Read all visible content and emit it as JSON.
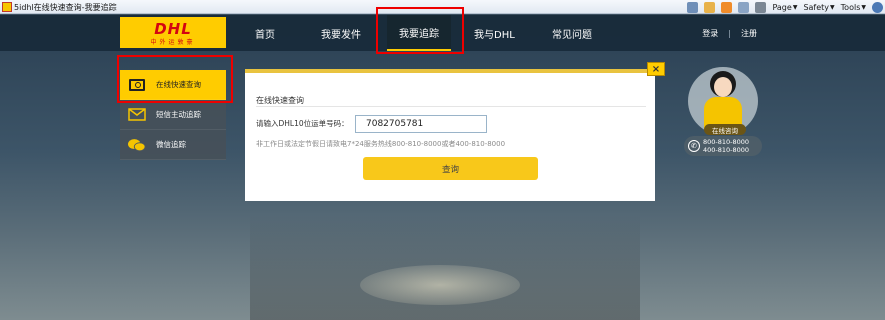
{
  "browser": {
    "tab_title": "5idhl在线快速查询-我要追踪",
    "commands": [
      "Page",
      "Safety",
      "Tools"
    ],
    "icons": [
      "home-icon",
      "favorites-icon",
      "rss-icon",
      "mail-icon",
      "print-icon",
      "help-icon"
    ]
  },
  "brand": {
    "logo_mark": "DHL",
    "logo_sub": "中外运敦豪",
    "accent": "#ffcc00",
    "red": "#d40511"
  },
  "nav": {
    "items": [
      {
        "label": "首页"
      },
      {
        "label": "我要发件"
      },
      {
        "label": "我要追踪"
      },
      {
        "label": "我与DHL"
      },
      {
        "label": "常见问题"
      }
    ],
    "active": "我要追踪",
    "login": "登录",
    "separator": "|",
    "register": "注册"
  },
  "sidebar": {
    "items": [
      {
        "label": "在线快速查询",
        "icon": "monitor-search-icon"
      },
      {
        "label": "短信主动追踪",
        "icon": "envelope-icon"
      },
      {
        "label": "微信追踪",
        "icon": "wechat-icon"
      }
    ]
  },
  "dialog": {
    "close": "×",
    "title": "在线快速查询",
    "label": "请输入DHL10位运单号码：",
    "input_value": "7082705781",
    "hint": "非工作日或法定节假日请致电7*24服务热线800-810-8000或者400-810-8000",
    "submit": "查询"
  },
  "support": {
    "badge": "在线咨询",
    "phones": [
      "800-810-8000",
      "400-810-8000"
    ]
  }
}
